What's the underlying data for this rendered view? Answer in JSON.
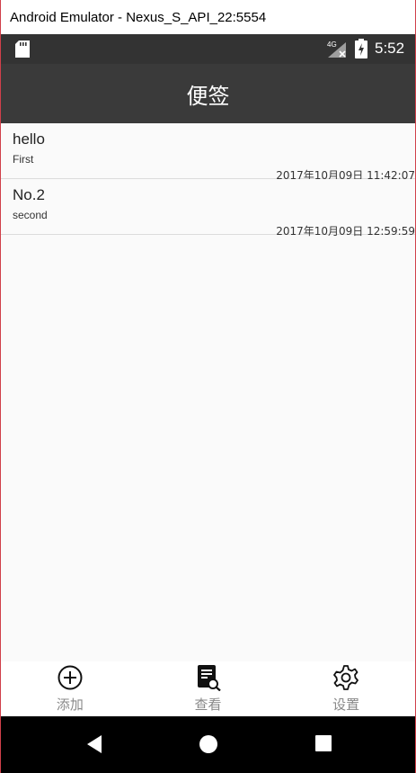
{
  "window": {
    "title": "Android Emulator - Nexus_S_API_22:5554"
  },
  "status_bar": {
    "network_label": "4G",
    "time": "5:52"
  },
  "app_bar": {
    "title": "便签"
  },
  "notes": [
    {
      "title": "hello",
      "subtitle": "First",
      "timestamp": "2017年10月09日 11:42:07"
    },
    {
      "title": "No.2",
      "subtitle": "second",
      "timestamp": "2017年10月09日 12:59:59"
    }
  ],
  "bottom_nav": {
    "items": [
      {
        "label": "添加",
        "icon": "add-circle-icon"
      },
      {
        "label": "查看",
        "icon": "search-document-icon"
      },
      {
        "label": "设置",
        "icon": "gear-icon"
      }
    ]
  },
  "system_nav": {
    "icons": [
      "back-icon",
      "home-icon",
      "recents-icon"
    ]
  },
  "colors": {
    "app_bar": "#3a3a3a",
    "status_bar": "#333333",
    "nav_label": "#888888"
  }
}
